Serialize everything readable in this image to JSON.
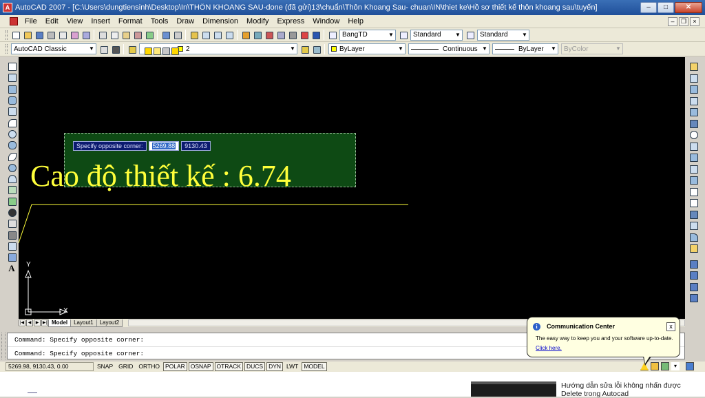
{
  "window": {
    "title": "AutoCAD 2007 - [C:\\Users\\dungtiensinh\\Desktop\\In\\THÔN KHOANG SAU-done (đã gửi)13\\chuẩn\\Thôn Khoang Sau- chuan\\IN\\thiet ke\\Hồ sơ thiết kế thôn khoang sau\\tuyến]",
    "minimize": "–",
    "maximize": "□",
    "close": "✕",
    "doc_minimize": "–",
    "doc_restore": "❐",
    "doc_close": "×"
  },
  "menu": [
    "File",
    "Edit",
    "View",
    "Insert",
    "Format",
    "Tools",
    "Draw",
    "Dimension",
    "Modify",
    "Express",
    "Window",
    "Help"
  ],
  "toolbar1": {
    "dimstyle": "BangTD",
    "textstyle": "Standard",
    "tablestyle": "Standard"
  },
  "toolbar2": {
    "workspace": "AutoCAD Classic",
    "layer": "2",
    "color": "ByLayer",
    "linetype": "Continuous",
    "lineweight": "ByLayer",
    "plotstyle": "ByColor"
  },
  "drawing": {
    "text": "Cao độ thiết kế : 6.74",
    "prompt": "Specify opposite corner:",
    "coord_x": "5269.88",
    "coord_y": "9130.43",
    "ucs_y": "Y",
    "ucs_x": "X"
  },
  "left_tool_letter": "A",
  "tabs": {
    "nav": [
      "|◀",
      "◀",
      "▶",
      "▶|"
    ],
    "items": [
      "Model",
      "Layout1",
      "Layout2"
    ]
  },
  "command": {
    "lines": [
      "Command: Specify opposite corner:",
      "Command: Specify opposite corner:"
    ]
  },
  "status": {
    "coords": "5269.98, 9130.43, 0.00",
    "buttons": [
      "SNAP",
      "GRID",
      "ORTHO",
      "POLAR",
      "OSNAP",
      "OTRACK",
      "DUCS",
      "DYN",
      "LWT",
      "MODEL"
    ]
  },
  "balloon": {
    "title": "Communication Center",
    "message": "The easy way to keep you and your software up-to-date.",
    "link": "Click here.",
    "close": "x",
    "info": "i"
  },
  "bottom": {
    "caption": "Hướng dẫn sửa lỗi không nhấn được Delete trong Autocad"
  },
  "colors": {
    "canvas": "#000000",
    "text_yellow": "#ffff3a",
    "selection_fill": "#0e4a14",
    "dyn_input": "#0b1a6f"
  }
}
